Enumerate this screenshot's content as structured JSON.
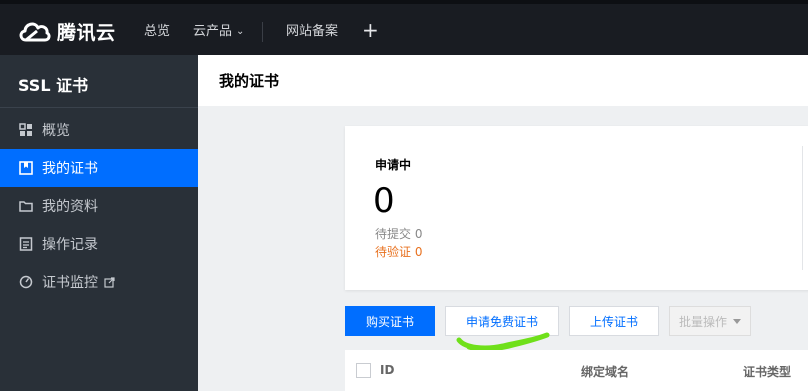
{
  "topbar": {
    "brand": "腾讯云",
    "nav": [
      "总览",
      "云产品",
      "网站备案"
    ],
    "add_icon": "plus-icon"
  },
  "sidebar": {
    "title": "SSL 证书",
    "items": [
      {
        "label": "概览",
        "icon": "grid-icon"
      },
      {
        "label": "我的证书",
        "icon": "certificate-icon",
        "active": true
      },
      {
        "label": "我的资料",
        "icon": "folder-icon"
      },
      {
        "label": "操作记录",
        "icon": "list-icon"
      },
      {
        "label": "证书监控",
        "icon": "gauge-icon",
        "external": true
      }
    ]
  },
  "page": {
    "title": "我的证书"
  },
  "card": {
    "title": "申请中",
    "count": "0",
    "pending_submit": "待提交 0",
    "pending_verify": "待验证 0"
  },
  "actions": {
    "buy": "购买证书",
    "apply_free": "申请免费证书",
    "upload": "上传证书",
    "batch": "批量操作"
  },
  "table": {
    "columns": [
      "ID",
      "绑定域名",
      "证书类型"
    ]
  },
  "colors": {
    "accent": "#006eff",
    "warning": "#e8711f",
    "annotation": "#6fe01a"
  }
}
